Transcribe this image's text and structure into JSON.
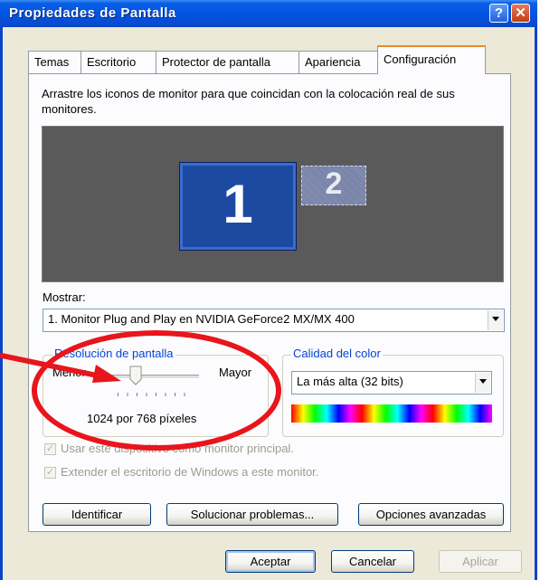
{
  "window": {
    "title": "Propiedades de Pantalla",
    "help_glyph": "?",
    "close_glyph": "✕"
  },
  "tabs": [
    {
      "label": "Temas",
      "active": false
    },
    {
      "label": "Escritorio",
      "active": false
    },
    {
      "label": "Protector de pantalla",
      "active": false
    },
    {
      "label": "Apariencia",
      "active": false
    },
    {
      "label": "Configuración",
      "active": true
    }
  ],
  "instruction_text": "Arrastre los iconos de monitor para que coincidan con la colocación real de sus monitores.",
  "monitors": [
    {
      "number": "1",
      "selected": true
    },
    {
      "number": "2",
      "selected": false
    }
  ],
  "display": {
    "label": "Mostrar:",
    "selected": "1. Monitor Plug and Play en NVIDIA GeForce2 MX/MX 400"
  },
  "resolution": {
    "group_label": "Resolución de pantalla",
    "min_label": "Menor",
    "max_label": "Mayor",
    "value_text": "1024 por 768 píxeles",
    "slider_fraction": 0.33
  },
  "color_quality": {
    "group_label": "Calidad del color",
    "selected": "La más alta (32 bits)"
  },
  "checkboxes": [
    {
      "label": "Usar este dispositivo como monitor principal.",
      "checked": true,
      "enabled": false
    },
    {
      "label": "Extender el escritorio de Windows a este monitor.",
      "checked": true,
      "enabled": false
    }
  ],
  "panel_buttons": {
    "identify": "Identificar",
    "troubleshoot": "Solucionar problemas...",
    "advanced": "Opciones avanzadas"
  },
  "dialog_buttons": {
    "ok": "Aceptar",
    "cancel": "Cancelar",
    "apply": "Aplicar"
  },
  "colors": {
    "titlebar": "#0054e3",
    "annotation": "#e8151c",
    "group_label": "#0046d5",
    "active_tab_accent": "#e68b2c"
  }
}
